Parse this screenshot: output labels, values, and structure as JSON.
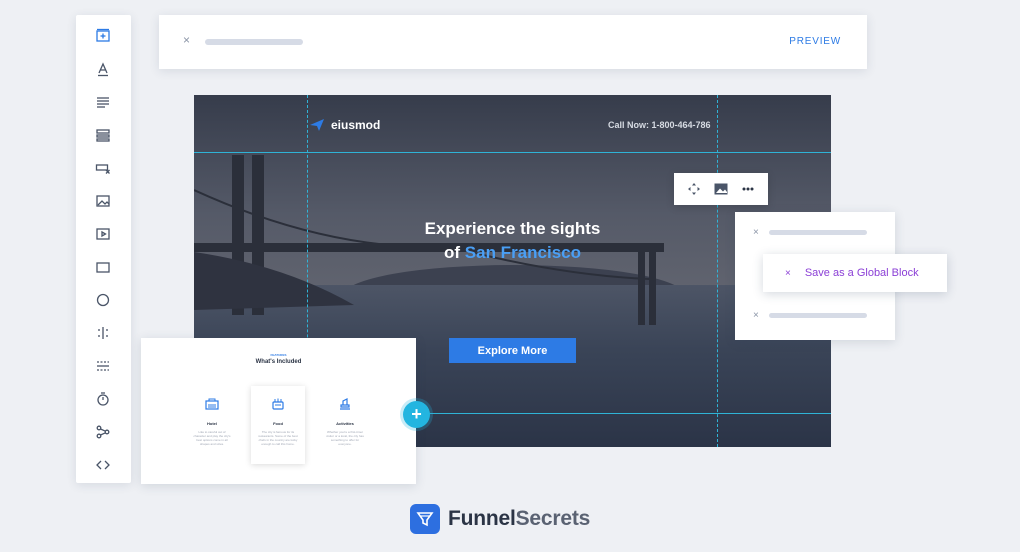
{
  "topbar": {
    "close_glyph": "×",
    "preview_label": "PREVIEW"
  },
  "toolbar": {
    "tools": [
      "section-icon",
      "text-icon",
      "paragraph-icon",
      "rows-icon",
      "input-icon",
      "image-icon",
      "video-icon",
      "box-icon",
      "circle-icon",
      "columns-icon",
      "divider-icon",
      "timer-icon",
      "share-icon",
      "code-icon"
    ]
  },
  "hero": {
    "brand_name": "eiusmod",
    "call_now": "Call Now: 1-800-464-786",
    "headline_line1": "Experience the sights",
    "headline_of": "of ",
    "headline_highlight": "San Francisco",
    "cta_label": "Explore More",
    "accent_color": "#2d7be5"
  },
  "floatbar": {
    "icons": [
      "move-icon",
      "image-icon",
      "more-icon"
    ]
  },
  "menucard": {
    "close_glyph": "×",
    "global_block_label": "Save as a Global Block"
  },
  "features": {
    "eyebrow": "FEATURES",
    "title": "What's Included",
    "items": [
      {
        "name": "Hotel",
        "desc": "Like to careful out of character and play the city's best options come in all shapes and sizes."
      },
      {
        "name": "Food",
        "desc": "The city is famous for its restaurants. Some of the best chefs in the country are lucky enough to call this home."
      },
      {
        "name": "Activities",
        "desc": "Whether you're a first-timer visitor or a local, the city has something to offer for everyone."
      }
    ]
  },
  "add_button_label": "+",
  "footer": {
    "word1": "Funnel",
    "word2": "Secrets",
    "brand_color": "#2d6fe0"
  }
}
